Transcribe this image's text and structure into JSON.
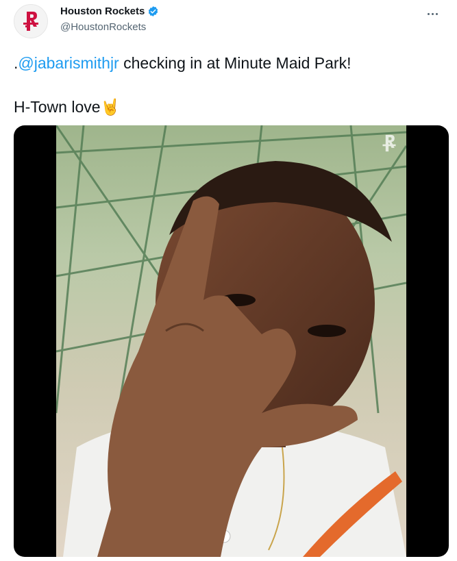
{
  "author": {
    "display_name": "Houston Rockets",
    "handle": "@HoustonRockets",
    "verified": true,
    "avatar_icon": "rockets-logo-icon"
  },
  "tweet": {
    "text_prefix": ".",
    "mention": "@jabarismithjr",
    "text_rest": " checking in at Minute Maid Park!",
    "second_line": "H-Town love",
    "emoji": "🤘"
  },
  "colors": {
    "link": "#1d9bf0",
    "secondary_text": "#536471",
    "verified": "#1d9bf0",
    "brand_red": "#ce1141"
  },
  "media": {
    "type": "video",
    "watermark_icon": "rockets-logo-icon"
  }
}
